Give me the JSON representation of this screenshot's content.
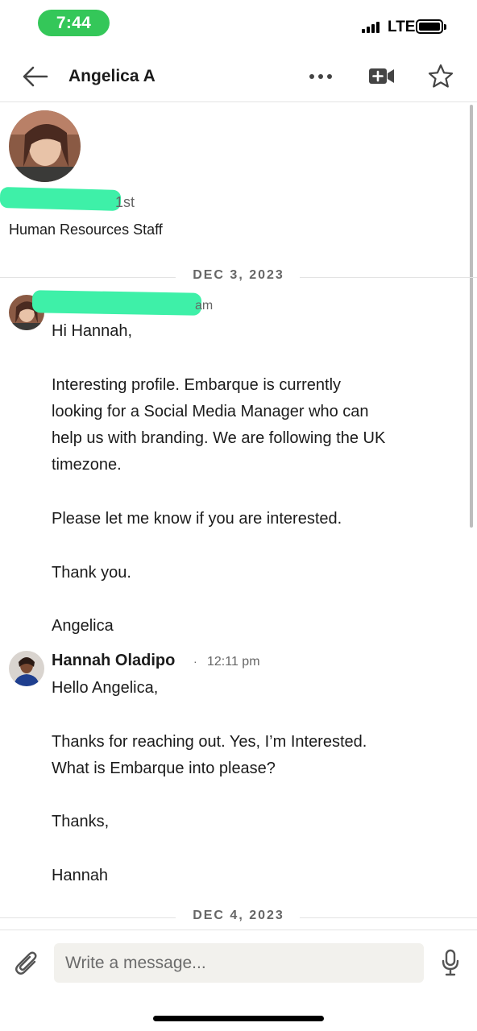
{
  "status_bar": {
    "time": "7:44",
    "network": "LTE",
    "accent_color": "#34c759"
  },
  "header": {
    "title": "Angelica A",
    "icons": [
      "back-arrow-icon",
      "more-icon",
      "video-call-icon",
      "star-icon"
    ]
  },
  "profile": {
    "degree": "1st",
    "headline": "Human Resources Staff"
  },
  "conversation": {
    "dividers": [
      "DEC 3, 2023",
      "DEC 4, 2023"
    ],
    "messages": [
      {
        "time_partial": "am",
        "lines": [
          "Hi Hannah,",
          "",
          "Interesting profile. Embarque is currently",
          "looking for a Social Media Manager who can",
          "help us with branding. We are following the UK",
          "timezone.",
          "",
          "Please let me know if you are interested.",
          "",
          "Thank you.",
          "",
          "Angelica"
        ]
      },
      {
        "sender": "Hannah Oladipo",
        "time": "12:11 pm",
        "lines": [
          "Hello Angelica,",
          "",
          "Thanks for reaching out. Yes, I’m Interested.",
          "What is Embarque into please?",
          "",
          "Thanks,",
          "",
          "Hannah"
        ]
      }
    ]
  },
  "compose": {
    "placeholder": "Write a message..."
  },
  "colors": {
    "redaction": "#3ef0a8",
    "text": "#1b1b1b",
    "muted": "#666666",
    "input_bg": "#f2f1ed"
  }
}
